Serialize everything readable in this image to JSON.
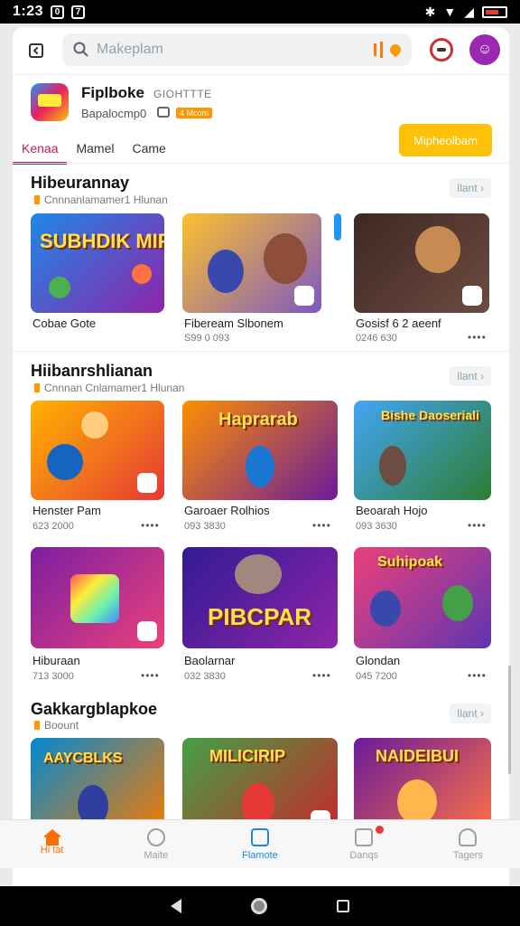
{
  "status_bar": {
    "time": "1:23",
    "icon1": "0",
    "icon2": "7"
  },
  "search": {
    "placeholder": "Makeplam"
  },
  "app": {
    "name": "Fiplboke",
    "tag": "GIOHTTTE",
    "subtitle": "Bapalocmp0",
    "badge": "4 Mcom"
  },
  "tabs": [
    "Kenaa",
    "Mamel",
    "Came"
  ],
  "cta_label": "Mipheolbam",
  "sections": [
    {
      "title": "Hibeurannay",
      "subtitle": "Cnnnanlamamer1 Hlunan",
      "more": "Ilant",
      "cards": [
        {
          "label": "Cobae Gote",
          "meta": "",
          "dots": "",
          "banner": "SUBHDIK MIPLASS"
        },
        {
          "label": "Fibeream Slbonem",
          "meta": "S99 0 093",
          "dots": "",
          "banner": ""
        },
        {
          "label": "Gosisf 6 2 aeenf",
          "meta": "0246 630",
          "dots": "••••",
          "banner": ""
        }
      ]
    },
    {
      "title": "Hiibanrshlianan",
      "subtitle": "Cnnnan Cnlamamer1 Hlunan",
      "more": "Ilant",
      "cards": [
        {
          "label": "Henster Pam",
          "meta": "623 2000",
          "dots": "••••",
          "banner": ""
        },
        {
          "label": "Garoaer Rolhios",
          "meta": "093 3830",
          "dots": "••••",
          "banner": "Haprarab"
        },
        {
          "label": "Beoarah Hojo",
          "meta": "093 3630",
          "dots": "••••",
          "banner": "Bishe Daoseriali"
        },
        {
          "label": "Hiburaan",
          "meta": "713 3000",
          "dots": "••••",
          "banner": ""
        },
        {
          "label": "Baolarnar",
          "meta": "032 3830",
          "dots": "••••",
          "banner": "PIBCPAR"
        },
        {
          "label": "Glondan",
          "meta": "045 7200",
          "dots": "••••",
          "banner": "Suhipoak"
        }
      ]
    },
    {
      "title": "Gakkargblapkoe",
      "subtitle": "Boount",
      "more": "Ilant",
      "cards": [
        {
          "label": "",
          "meta": "",
          "dots": "",
          "banner": "AAYCBLKS"
        },
        {
          "label": "",
          "meta": "",
          "dots": "",
          "banner": "MILICIRIP"
        },
        {
          "label": "",
          "meta": "",
          "dots": "",
          "banner": "NAIDEIBUI"
        }
      ]
    }
  ],
  "bottom_nav": [
    "Hi tat",
    "Maite",
    "Flamote",
    "Danqs",
    "Tagers"
  ],
  "colors": {
    "accent": "#c2185b",
    "cta": "#ffc107",
    "home_active": "#ff6d00",
    "nav_blue": "#1e88e5",
    "profile": "#9c27b0"
  },
  "icons": [
    "back-icon",
    "search-icon",
    "mic-icon",
    "location-icon",
    "mascot-icon",
    "profile-icon",
    "chat-icon",
    "chevron-right-icon",
    "home-icon",
    "clock-icon",
    "square-icon",
    "person-icon"
  ]
}
